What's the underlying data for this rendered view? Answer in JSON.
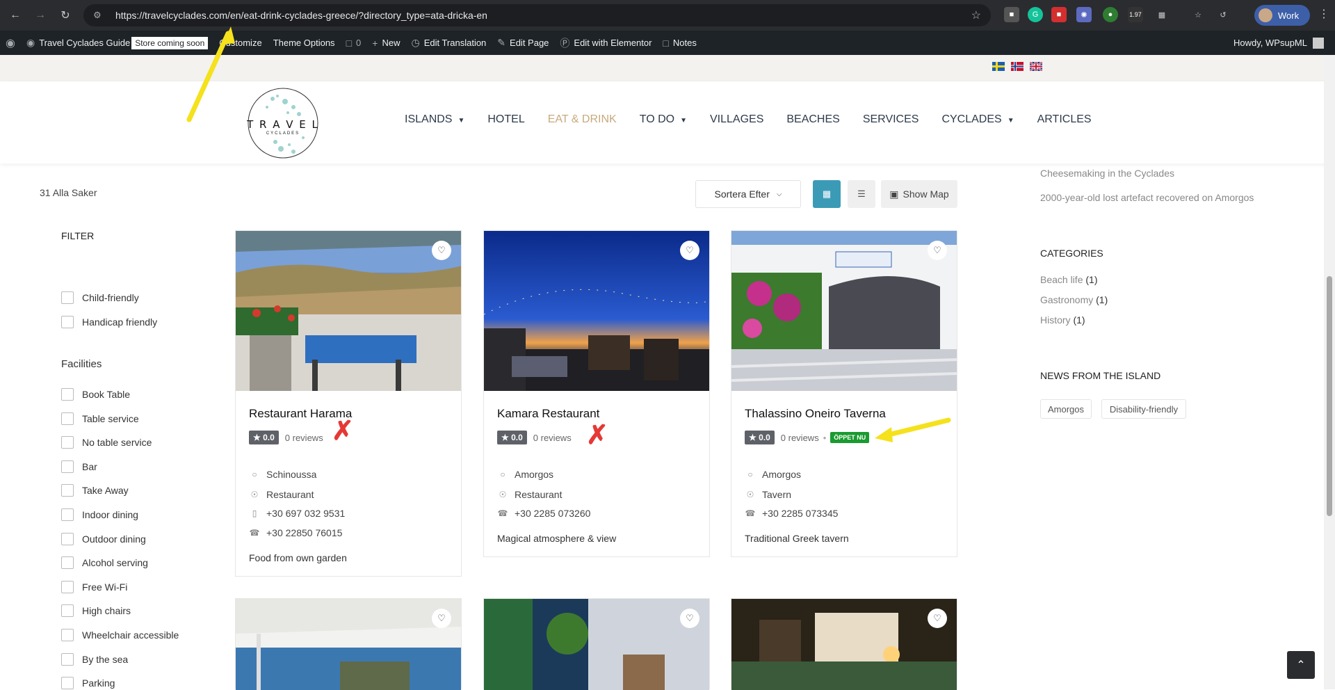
{
  "browser": {
    "url": "https://travelcyclades.com/en/eat-drink-cyclades-greece/?directory_type=ata-dricka-en",
    "profile_label": "Work",
    "ext_badges": [
      "1",
      "1",
      "1.97"
    ]
  },
  "admin_bar": {
    "site_name": "Travel Cyclades Guide",
    "store_notice": "Store coming soon",
    "customize": "Customize",
    "theme_options": "Theme Options",
    "comments_count": "0",
    "new": "New",
    "edit_translation": "Edit Translation",
    "edit_page": "Edit Page",
    "edit_elementor": "Edit with Elementor",
    "notes": "Notes",
    "howdy": "Howdy, WPsupML"
  },
  "logo": {
    "line1": "T R A V E L",
    "line2": "CYCLADES"
  },
  "menu": [
    {
      "label": "ISLANDS",
      "caret": true
    },
    {
      "label": "HOTEL",
      "caret": false
    },
    {
      "label": "EAT & DRINK",
      "caret": false,
      "active": true
    },
    {
      "label": "TO DO",
      "caret": true
    },
    {
      "label": "VILLAGES",
      "caret": false
    },
    {
      "label": "BEACHES",
      "caret": false
    },
    {
      "label": "SERVICES",
      "caret": false
    },
    {
      "label": "CYCLADES",
      "caret": true
    },
    {
      "label": "ARTICLES",
      "caret": false
    }
  ],
  "toolbar": {
    "count": "31 Alla Saker",
    "sort_label": "Sortera Efter",
    "show_map": "Show Map"
  },
  "filter": {
    "title": "FILTER",
    "top_options": [
      "Child-friendly",
      "Handicap friendly"
    ],
    "facilities_title": "Facilities",
    "facilities": [
      "Book Table",
      "Table service",
      "No table service",
      "Bar",
      "Take Away",
      "Indoor dining",
      "Outdoor dining",
      "Alcohol serving",
      "Free Wi-Fi",
      "High chairs",
      "Wheelchair accessible",
      "By the sea",
      "Parking"
    ]
  },
  "cards": [
    {
      "title": "Restaurant Harama",
      "rating": "0.0",
      "reviews": "0 reviews",
      "location": "Schinoussa",
      "category": "Restaurant",
      "mobile": "+30 697 032 9531",
      "phone": "+30 22850 76015",
      "description": "Food from own garden"
    },
    {
      "title": "Kamara Restaurant",
      "rating": "0.0",
      "reviews": "0 reviews",
      "location": "Amorgos",
      "category": "Restaurant",
      "phone": "+30 2285 073260",
      "description": "Magical atmosphere & view"
    },
    {
      "title": "Thalassino Oneiro Taverna",
      "rating": "0.0",
      "reviews": "0 reviews",
      "open_badge": "ÖPPET NU",
      "location": "Amorgos",
      "category": "Tavern",
      "phone": "+30 2285 073345",
      "description": "Traditional Greek tavern"
    }
  ],
  "sidebar": {
    "recent": [
      "Cheesemaking in the Cyclades",
      "2000-year-old lost artefact recovered on Amorgos"
    ],
    "categories_title": "CATEGORIES",
    "categories": [
      {
        "name": "Beach life",
        "count": "(1)"
      },
      {
        "name": "Gastronomy",
        "count": "(1)"
      },
      {
        "name": "History",
        "count": "(1)"
      }
    ],
    "news_title": "NEWS FROM THE ISLAND",
    "tags": [
      "Amorgos",
      "Disability-friendly"
    ]
  },
  "colors": {
    "accent": "#c7a97c",
    "grid_active": "#3b9bb7",
    "open_green": "#1a9b2f",
    "annotation_yellow": "#f5e11c",
    "annotation_red": "#e53935"
  }
}
